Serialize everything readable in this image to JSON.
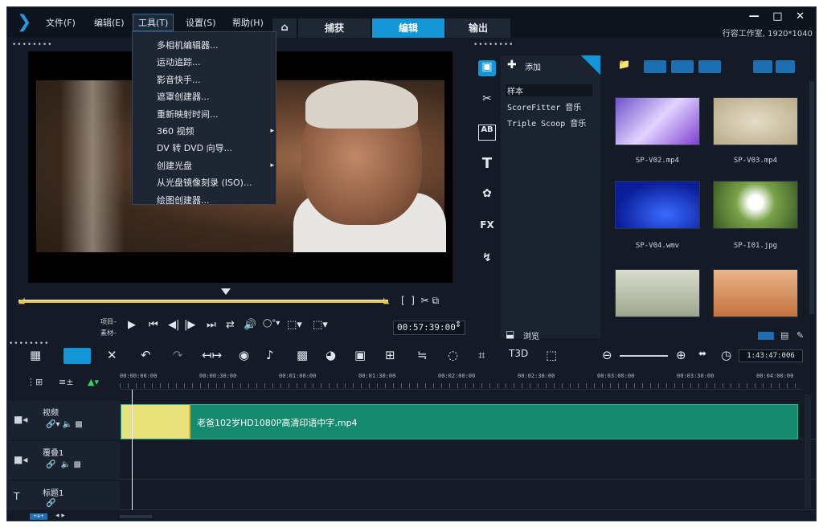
{
  "menubar": {
    "items": [
      "文件(F)",
      "编辑(E)",
      "工具(T)",
      "设置(S)",
      "帮助(H)"
    ],
    "tabs": [
      "捕获",
      "编辑",
      "输出"
    ],
    "window_title": "行容工作室, 1920*1040",
    "window_controls": "— □ ✕"
  },
  "tools_menu": {
    "items": [
      "多相机编辑器...",
      "运动追踪...",
      "影音快手...",
      "遮罩创建器...",
      "重新映射时间...",
      "360 视频",
      "DV 转 DVD 向导...",
      "创建光盘",
      "从光盘镜像刻录 (ISO)...",
      "绘图创建器..."
    ],
    "submenu_marker": "▸"
  },
  "preview": {
    "dots": "••••••••",
    "mode_project": "项目–",
    "mode_clip": "素材–",
    "timecode": "00:57:39:00",
    "scrub_position": 0.56
  },
  "library": {
    "dots": "••••••••",
    "add_label": "添加",
    "tree": [
      "样本",
      "ScoreFitter 音乐",
      "Triple Scoop 音乐"
    ],
    "browse_label": "浏览",
    "thumbs": [
      {
        "label": "SP-V02.mp4"
      },
      {
        "label": "SP-V03.mp4"
      },
      {
        "label": "SP-V04.wmv"
      },
      {
        "label": "SP-I01.jpg"
      },
      {
        "label": ""
      },
      {
        "label": ""
      }
    ],
    "side_icons": [
      "media-icon",
      "transition-icon",
      "title-icon",
      "text-icon",
      "graphic-icon",
      "fx-icon",
      "path-icon"
    ],
    "side_text": [
      "▣",
      "✂",
      "AB",
      "T",
      "✿",
      "FX",
      "↯"
    ]
  },
  "timeline": {
    "dots": "••••••••",
    "duration": "1:43:47:006",
    "ruler": [
      "00:00:00:00",
      "00:00:30:00",
      "00:01:00:00",
      "00:01:30:00",
      "00:02:00:00",
      "00:02:30:00",
      "00:03:00:00",
      "00:03:30:00",
      "00:04:00:00"
    ],
    "tracks": [
      {
        "name": "视频"
      },
      {
        "name": "覆叠1"
      },
      {
        "name": "标题1"
      }
    ],
    "clip_label": "老爸102岁HD1080P高清印语中字.mp4",
    "zoom_label": "+a+"
  }
}
